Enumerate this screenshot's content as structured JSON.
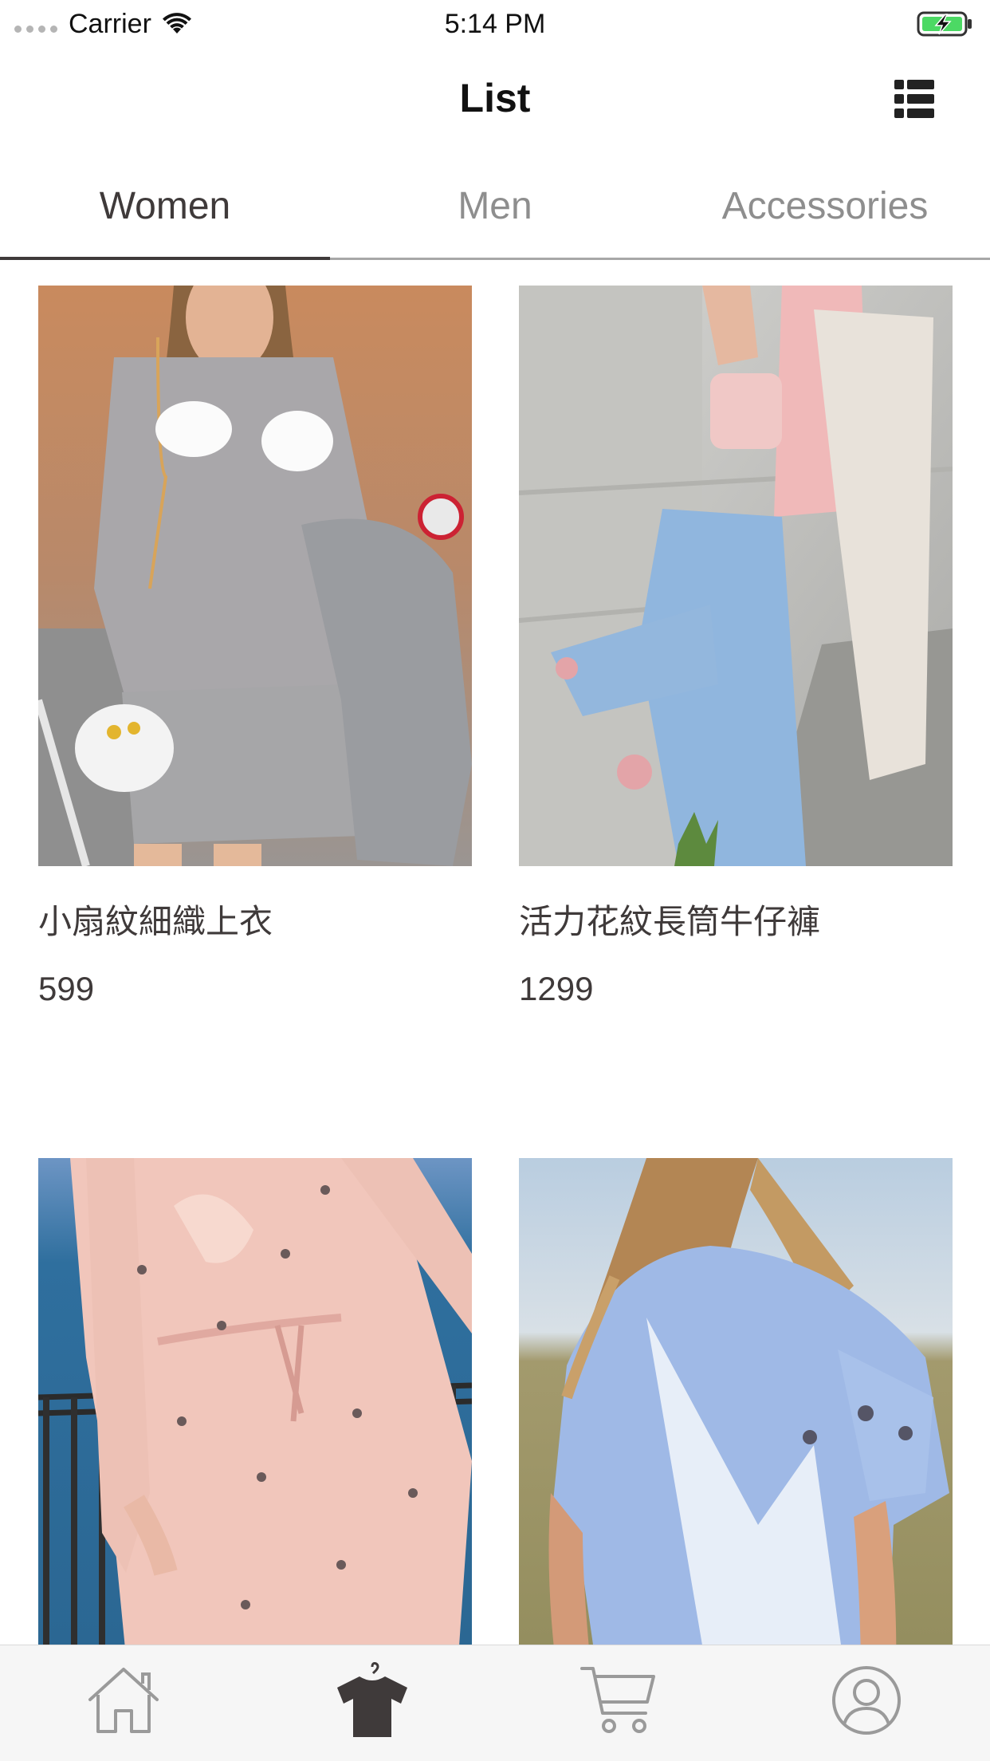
{
  "status_bar": {
    "carrier": "Carrier",
    "time": "5:14 PM",
    "icons": [
      "signal-dots-icon",
      "wifi-icon",
      "battery-charging-icon"
    ]
  },
  "nav": {
    "title": "List",
    "right_icon": "list-view-icon"
  },
  "tabs": [
    {
      "label": "Women",
      "active": true
    },
    {
      "label": "Men",
      "active": false
    },
    {
      "label": "Accessories",
      "active": false
    }
  ],
  "products": [
    {
      "name": "小扇紋細織上衣",
      "price": "599"
    },
    {
      "name": "活力花紋長筒牛仔褲",
      "price": "1299"
    },
    {
      "name": "",
      "price": ""
    },
    {
      "name": "",
      "price": ""
    }
  ],
  "tab_bar": {
    "items": [
      {
        "icon": "home-icon",
        "active": false
      },
      {
        "icon": "tshirt-icon",
        "active": true
      },
      {
        "icon": "cart-icon",
        "active": false
      },
      {
        "icon": "profile-icon",
        "active": false
      }
    ]
  },
  "colors": {
    "text_primary": "#3f3a3a",
    "tab_inactive": "#8e8e8e",
    "tab_indicator": "#3f3a3a",
    "icon_inactive": "#9a9a9a",
    "icon_active": "#3f3a3a",
    "battery_green": "#4cd964"
  }
}
